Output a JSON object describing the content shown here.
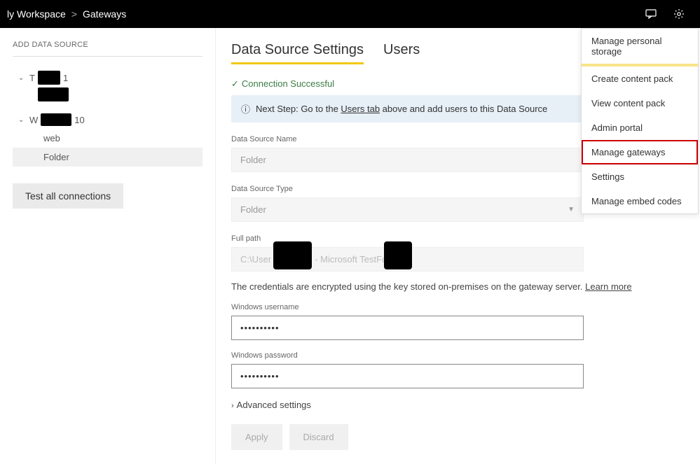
{
  "breadcrumb": {
    "part1": "ly Workspace",
    "sep": ">",
    "part2": "Gateways"
  },
  "sidebar": {
    "add_label": "ADD DATA SOURCE",
    "gateways": [
      {
        "prefix": "T",
        "suffix": "1"
      },
      {
        "prefix": "W",
        "suffix": "10"
      }
    ],
    "sources": [
      "web",
      "Folder"
    ],
    "test_label": "Test all connections"
  },
  "tabs": {
    "settings": "Data Source Settings",
    "users": "Users"
  },
  "status": {
    "text": "Connection Successful"
  },
  "infobar": {
    "lead": "Next Step: Go to the ",
    "link": "Users tab",
    "tail": " above and add users to this Data Source"
  },
  "fields": {
    "name_label": "Data Source Name",
    "name_value": "Folder",
    "type_label": "Data Source Type",
    "type_value": "Folder",
    "path_label": "Full path",
    "path_value": "C:\\User            OneDrive - Microsoft         TestFolder",
    "enc_text": "The credentials are encrypted using the key stored on-premises on the gateway server. ",
    "enc_link": "Learn more",
    "user_label": "Windows username",
    "user_value": "••••••••••",
    "pass_label": "Windows password",
    "pass_value": "••••••••••",
    "advanced": "Advanced settings"
  },
  "buttons": {
    "apply": "Apply",
    "discard": "Discard"
  },
  "menu": {
    "items": [
      "Manage personal storage",
      "Create content pack",
      "View content pack",
      "Admin portal",
      "Manage gateways",
      "Settings",
      "Manage embed codes"
    ]
  }
}
